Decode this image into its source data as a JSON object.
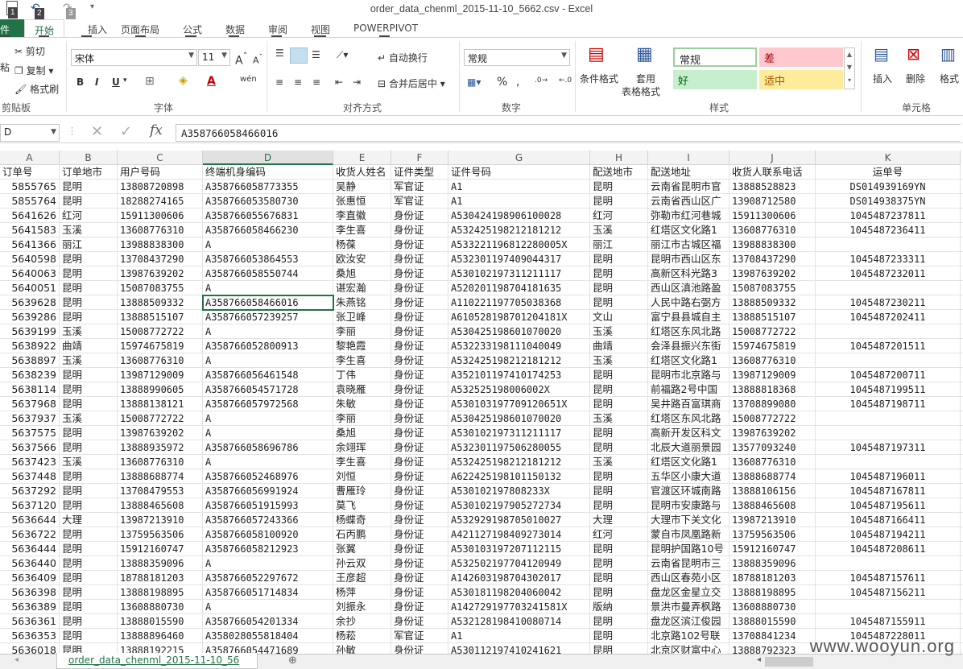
{
  "window": {
    "title": "order_data_chenml_2015-11-10_5662.csv - Excel"
  },
  "qat": {
    "keytips": [
      "1",
      "2",
      "3"
    ]
  },
  "tabs": [
    {
      "label": "件",
      "keytip": "F"
    },
    {
      "label": "开始",
      "keytip": "H"
    },
    {
      "label": "插入",
      "keytip": "N"
    },
    {
      "label": "页面布局",
      "keytip": "P"
    },
    {
      "label": "公式",
      "keytip": "M"
    },
    {
      "label": "数据",
      "keytip": "A"
    },
    {
      "label": "审阅",
      "keytip": "R"
    },
    {
      "label": "视图",
      "keytip": "W"
    },
    {
      "label": "POWERPIVOT",
      "keytip": "B"
    }
  ],
  "ribbon": {
    "clipboard": {
      "cut": "剪切",
      "copy": "复制",
      "format_painter": "格式刷",
      "paste": "粘",
      "group": "剪贴板"
    },
    "font": {
      "name": "宋体",
      "size": "11",
      "group": "字体",
      "bold": "B",
      "italic": "I",
      "underline": "U",
      "phonetic": "wén"
    },
    "alignment": {
      "wrap": "自动换行",
      "merge": "合并后居中",
      "group": "对齐方式"
    },
    "number": {
      "format": "常规",
      "group": "数字",
      "percent": "%",
      "comma": ","
    },
    "styles": {
      "cond": "条件格式",
      "table1": "套用",
      "table2": "表格格式",
      "normal": "常规",
      "bad": "差",
      "good": "好",
      "neutral": "适中",
      "group": "样式"
    },
    "cells": {
      "insert": "插入",
      "delete": "删除",
      "format": "格式",
      "group": "单元格"
    }
  },
  "formula_bar": {
    "name_box": "D",
    "value": "A358766058466016",
    "fx": "fx"
  },
  "columns": [
    {
      "letter": "A",
      "header": "订单号"
    },
    {
      "letter": "B",
      "header": "订单地市"
    },
    {
      "letter": "C",
      "header": "用户号码"
    },
    {
      "letter": "D",
      "header": "终端机身编码"
    },
    {
      "letter": "E",
      "header": "收货人姓名"
    },
    {
      "letter": "F",
      "header": "证件类型"
    },
    {
      "letter": "G",
      "header": "证件号码"
    },
    {
      "letter": "H",
      "header": "配送地市"
    },
    {
      "letter": "I",
      "header": "配送地址"
    },
    {
      "letter": "J",
      "header": "收货人联系电话"
    },
    {
      "letter": "K",
      "header": "运单号"
    }
  ],
  "rows": [
    [
      "5855765",
      "昆明",
      "13808720898",
      "A358766058773355",
      "吴静",
      "军官证",
      "A1",
      "昆明",
      "云南省昆明市官",
      "13888528823",
      "DS014939169YN"
    ],
    [
      "5855764",
      "昆明",
      "18288274165",
      "A358766053580730",
      "张惠恒",
      "军官证",
      "A1",
      "昆明",
      "云南省西山区广",
      "13908712580",
      "DS014938375YN"
    ],
    [
      "5641626",
      "红河",
      "15911300606",
      "A358766055676831",
      "李直徽",
      "身份证",
      "A530424198906100028",
      "红河",
      "弥勒市红河巷城",
      "15911300606",
      "1045487237811"
    ],
    [
      "5641583",
      "玉溪",
      "13608776310",
      "A358766058466230",
      "李生喜",
      "身份证",
      "A532425198212181212",
      "玉溪",
      "红塔区文化路1",
      "13608776310",
      "1045487236411"
    ],
    [
      "5641366",
      "丽江",
      "13988838300",
      "A",
      "杨葆",
      "身份证",
      "A533221196812280005X",
      "丽江",
      "丽江市古城区福",
      "13988838300",
      ""
    ],
    [
      "5640598",
      "昆明",
      "13708437290",
      "A358766053864553",
      "欧汝安",
      "身份证",
      "A532301197409044317",
      "昆明",
      "昆明市西山区东",
      "13708437290",
      "1045487233311"
    ],
    [
      "5640063",
      "昆明",
      "13987639202",
      "A358766058550744",
      "桑旭",
      "身份证",
      "A530102197311211117",
      "昆明",
      "高新区科光路3",
      "13987639202",
      "1045487232011"
    ],
    [
      "5640051",
      "昆明",
      "15087083755",
      "A",
      "谌宏瀚",
      "身份证",
      "A520201198704181635",
      "昆明",
      "西山区滇池路盈",
      "15087083755",
      ""
    ],
    [
      "5639628",
      "昆明",
      "13888509332",
      "A358766058466016",
      "朱燕铭",
      "身份证",
      "A110221197705038368",
      "昆明",
      "人民中路右弼方",
      "13888509332",
      "1045487230211"
    ],
    [
      "5639286",
      "昆明",
      "13888515107",
      "A358766057239257",
      "张卫峰",
      "身份证",
      "A610528198701204181X",
      "文山",
      "富宁县县城自主",
      "13888515107",
      "1045487202411"
    ],
    [
      "5639199",
      "玉溪",
      "15008772722",
      "A",
      "李丽",
      "身份证",
      "A530425198601070020",
      "玉溪",
      "红塔区东风北路",
      "15008772722",
      ""
    ],
    [
      "5638922",
      "曲靖",
      "15974675819",
      "A358766052800913",
      "黎艳霞",
      "身份证",
      "A532233198111040049",
      "曲靖",
      "会泽县振兴东街",
      "15974675819",
      "1045487201511"
    ],
    [
      "5638897",
      "玉溪",
      "13608776310",
      "A",
      "李生喜",
      "身份证",
      "A532425198212181212",
      "玉溪",
      "红塔区文化路1",
      "13608776310",
      ""
    ],
    [
      "5638239",
      "昆明",
      "13987129009",
      "A358766056461548",
      "丁伟",
      "身份证",
      "A352101197410174253",
      "昆明",
      "昆明市北京路与",
      "13987129009",
      "1045487200711"
    ],
    [
      "5638114",
      "昆明",
      "13888990605",
      "A358766054571728",
      "袁晓雁",
      "身份证",
      "A532525198006002X",
      "昆明",
      "前福路2号中国",
      "13888818368",
      "1045487199511"
    ],
    [
      "5637968",
      "昆明",
      "13888138121",
      "A358766057972568",
      "朱敏",
      "身份证",
      "A530103197709120651X",
      "昆明",
      "吴井路百富琪商",
      "13708899080",
      "1045487198711"
    ],
    [
      "5637937",
      "玉溪",
      "15008772722",
      "A",
      "李丽",
      "身份证",
      "A530425198601070020",
      "玉溪",
      "红塔区东风北路",
      "15008772722",
      ""
    ],
    [
      "5637575",
      "昆明",
      "13987639202",
      "A",
      "桑旭",
      "身份证",
      "A530102197311211117",
      "昆明",
      "高新开发区科文",
      "13987639202",
      ""
    ],
    [
      "5637566",
      "昆明",
      "13888935972",
      "A358766058696786",
      "余翊珲",
      "身份证",
      "A532301197506280055",
      "昆明",
      "北辰大道丽景园",
      "13577093240",
      "1045487197311"
    ],
    [
      "5637423",
      "玉溪",
      "13608776310",
      "A",
      "李生喜",
      "身份证",
      "A532425198212181212",
      "玉溪",
      "红塔区文化路1",
      "13608776310",
      ""
    ],
    [
      "5637448",
      "昆明",
      "13888688774",
      "A358766052468976",
      "刘恒",
      "身份证",
      "A622425198101150132",
      "昆明",
      "五华区小康大道",
      "13888688774",
      "1045487196011"
    ],
    [
      "5637292",
      "昆明",
      "13708479553",
      "A358766056991924",
      "曹雁玲",
      "身份证",
      "A530102197808233X",
      "昆明",
      "官渡区环城南路",
      "13888106156",
      "1045487167811"
    ],
    [
      "5637120",
      "昆明",
      "13888465608",
      "A358766051915993",
      "莫飞",
      "身份证",
      "A530102197905272734",
      "昆明",
      "昆明市安康路与",
      "13888465608",
      "1045487195611"
    ],
    [
      "5636644",
      "大理",
      "13987213910",
      "A358766057243366",
      "杨蝶奇",
      "身份证",
      "A532929198705010027",
      "大理",
      "大理市下关文化",
      "13987213910",
      "1045487166411"
    ],
    [
      "5636722",
      "昆明",
      "13759563506",
      "A358766058100920",
      "石丙鹏",
      "身份证",
      "A421127198409273014",
      "红河",
      "蒙自市凤凰路新",
      "13759563506",
      "1045487194211"
    ],
    [
      "5636444",
      "昆明",
      "15912160747",
      "A358766058212923",
      "张翼",
      "身份证",
      "A530103197207112115",
      "昆明",
      "昆明护国路10号",
      "15912160747",
      "1045487208611"
    ],
    [
      "5636440",
      "昆明",
      "13888359096",
      "A",
      "孙云双",
      "身份证",
      "A532502197704120949",
      "昆明",
      "云南省昆明市三",
      "13888359096",
      ""
    ],
    [
      "5636409",
      "昆明",
      "18788181203",
      "A358766052297672",
      "王彦超",
      "身份证",
      "A142603198704302017",
      "昆明",
      "西山区春苑小区",
      "18788181203",
      "1045487157611"
    ],
    [
      "5636398",
      "昆明",
      "13888198895",
      "A358766051714834",
      "杨萍",
      "身份证",
      "A530181198204060042",
      "昆明",
      "盘龙区金星立交",
      "13888198895",
      "1045487156211"
    ],
    [
      "5636389",
      "昆明",
      "13608880730",
      "A",
      "刘振永",
      "身份证",
      "A142729197703241581X",
      "版纳",
      "景洪市曼弄枫路",
      "13608880730",
      ""
    ],
    [
      "5636361",
      "昆明",
      "13888015590",
      "A358766054201334",
      "余抄",
      "身份证",
      "A532128198410080714",
      "昆明",
      "盘龙区滨江俊园",
      "13888015590",
      "1045487155911"
    ],
    [
      "5636353",
      "昆明",
      "13888896460",
      "A358028055818404",
      "杨菘",
      "军官证",
      "A1",
      "昆明",
      "北京路102号联",
      "13708841234",
      "1045487228011"
    ],
    [
      "5636018",
      "昆明",
      "13888192215",
      "A358766054471689",
      "孙敏",
      "身份证",
      "A530112197410241621",
      "昆明",
      "北京区财富中心",
      "13888792323",
      ""
    ]
  ],
  "sheet": {
    "tab": "order_data_chenml_2015-11-10_56"
  },
  "watermark": "www.wooyun.org"
}
